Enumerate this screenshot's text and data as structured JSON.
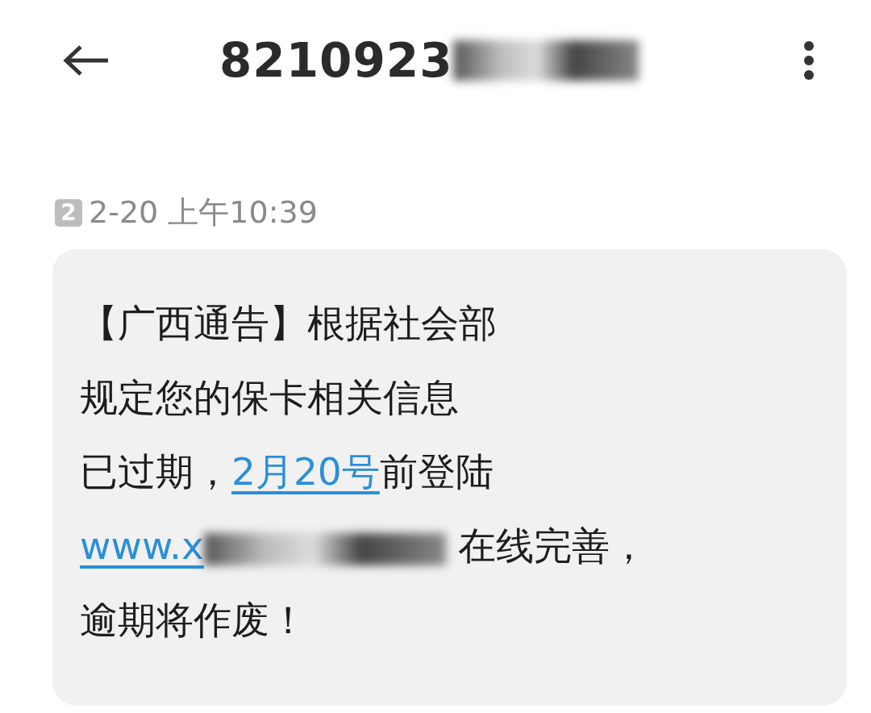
{
  "header": {
    "title": "8210923",
    "title_redacted": true
  },
  "timestamp": {
    "sim": "2",
    "time": "2-20 上午10:39"
  },
  "message": {
    "lines": [
      [
        {
          "kind": "text",
          "text": "【广西通告】根据社会部"
        }
      ],
      [
        {
          "kind": "text",
          "text": "规定您的保卡相关信息"
        }
      ],
      [
        {
          "kind": "text",
          "text": "已过期，"
        },
        {
          "kind": "link",
          "text": "2月20号",
          "redacted": false
        },
        {
          "kind": "text",
          "text": "前登陆"
        }
      ],
      [
        {
          "kind": "link",
          "text": "www.x",
          "redacted": true
        },
        {
          "kind": "text",
          "text": " 在线完善，"
        }
      ],
      [
        {
          "kind": "text",
          "text": "逾期将作废！"
        }
      ]
    ]
  }
}
